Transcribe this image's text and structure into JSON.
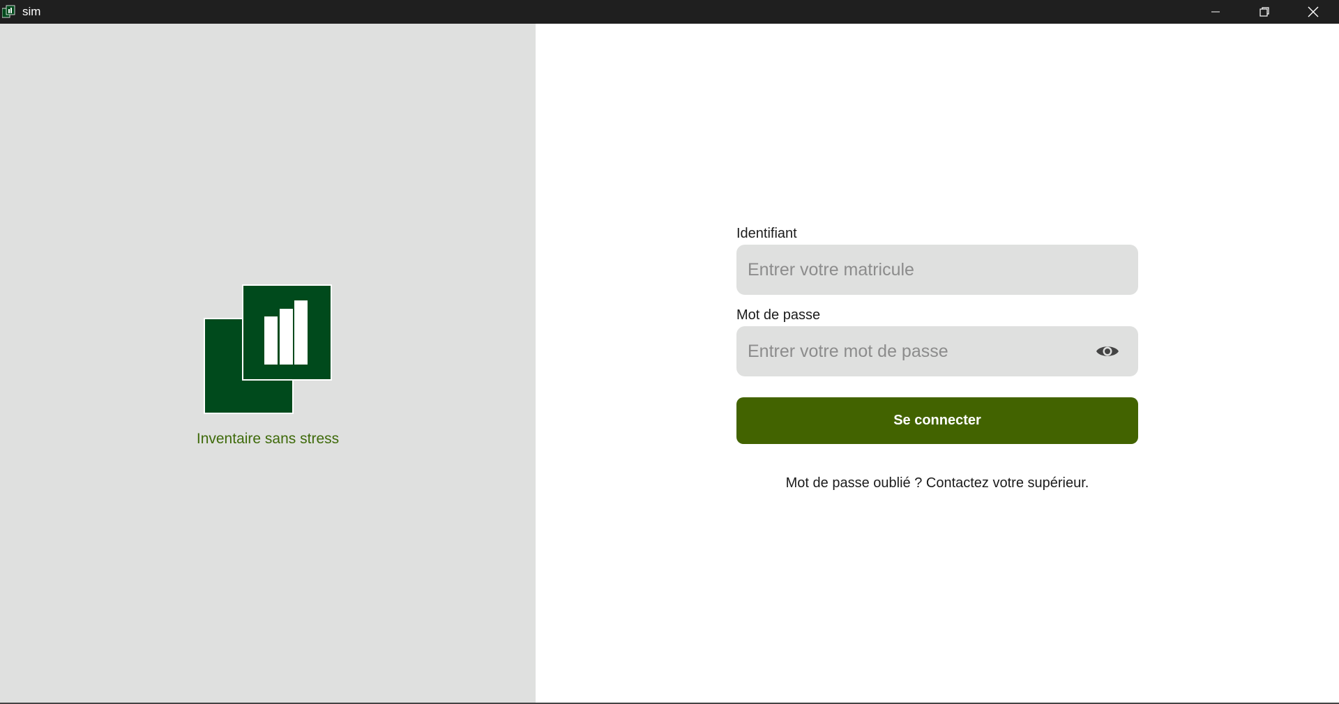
{
  "window": {
    "title": "sim",
    "icon": "app-logo-icon",
    "controls": {
      "minimize": "minimize-icon",
      "maximize": "restore-icon",
      "close": "close-icon"
    }
  },
  "brand": {
    "tagline": "Inventaire sans stress",
    "logo_icon": "inventory-logo",
    "colors": {
      "dark_green": "#004a1c",
      "accent": "#426300",
      "tagline": "#3e6a0a",
      "panel_bg": "#dfe0df"
    }
  },
  "login": {
    "username_label": "Identifiant",
    "username_placeholder": "Entrer votre matricule",
    "username_value": "",
    "password_label": "Mot de passe",
    "password_placeholder": "Entrer votre mot de passe",
    "password_value": "",
    "toggle_visibility_icon": "eye-icon",
    "submit_label": "Se connecter",
    "forgot_text": "Mot de passe oublié ? Contactez votre supérieur."
  }
}
